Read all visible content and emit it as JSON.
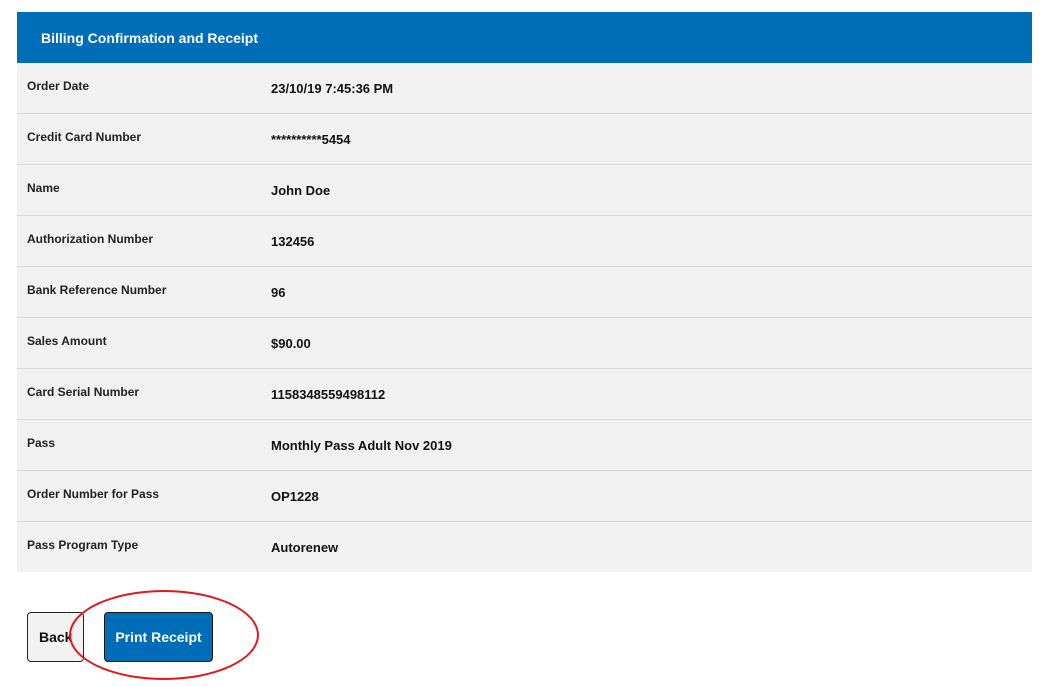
{
  "panel": {
    "title": "Billing Confirmation and Receipt",
    "rows": [
      {
        "label": "Order Date",
        "value": "23/10/19 7:45:36 PM"
      },
      {
        "label": "Credit Card Number",
        "value": "**********5454"
      },
      {
        "label": "Name",
        "value": "John Doe"
      },
      {
        "label": "Authorization Number",
        "value": "132456"
      },
      {
        "label": "Bank Reference Number",
        "value": "96"
      },
      {
        "label": "Sales Amount",
        "value": "$90.00"
      },
      {
        "label": "Card Serial Number",
        "value": "1158348559498112"
      },
      {
        "label": "Pass",
        "value": "Monthly Pass Adult Nov 2019"
      },
      {
        "label": "Order Number for Pass",
        "value": "OP1228"
      },
      {
        "label": "Pass Program Type",
        "value": "Autorenew"
      }
    ]
  },
  "actions": {
    "back_label": "Back",
    "print_label": "Print Receipt"
  },
  "colors": {
    "header_bg": "#006db8",
    "row_bg": "#f1f1f1",
    "annotation": "#e2161c"
  }
}
